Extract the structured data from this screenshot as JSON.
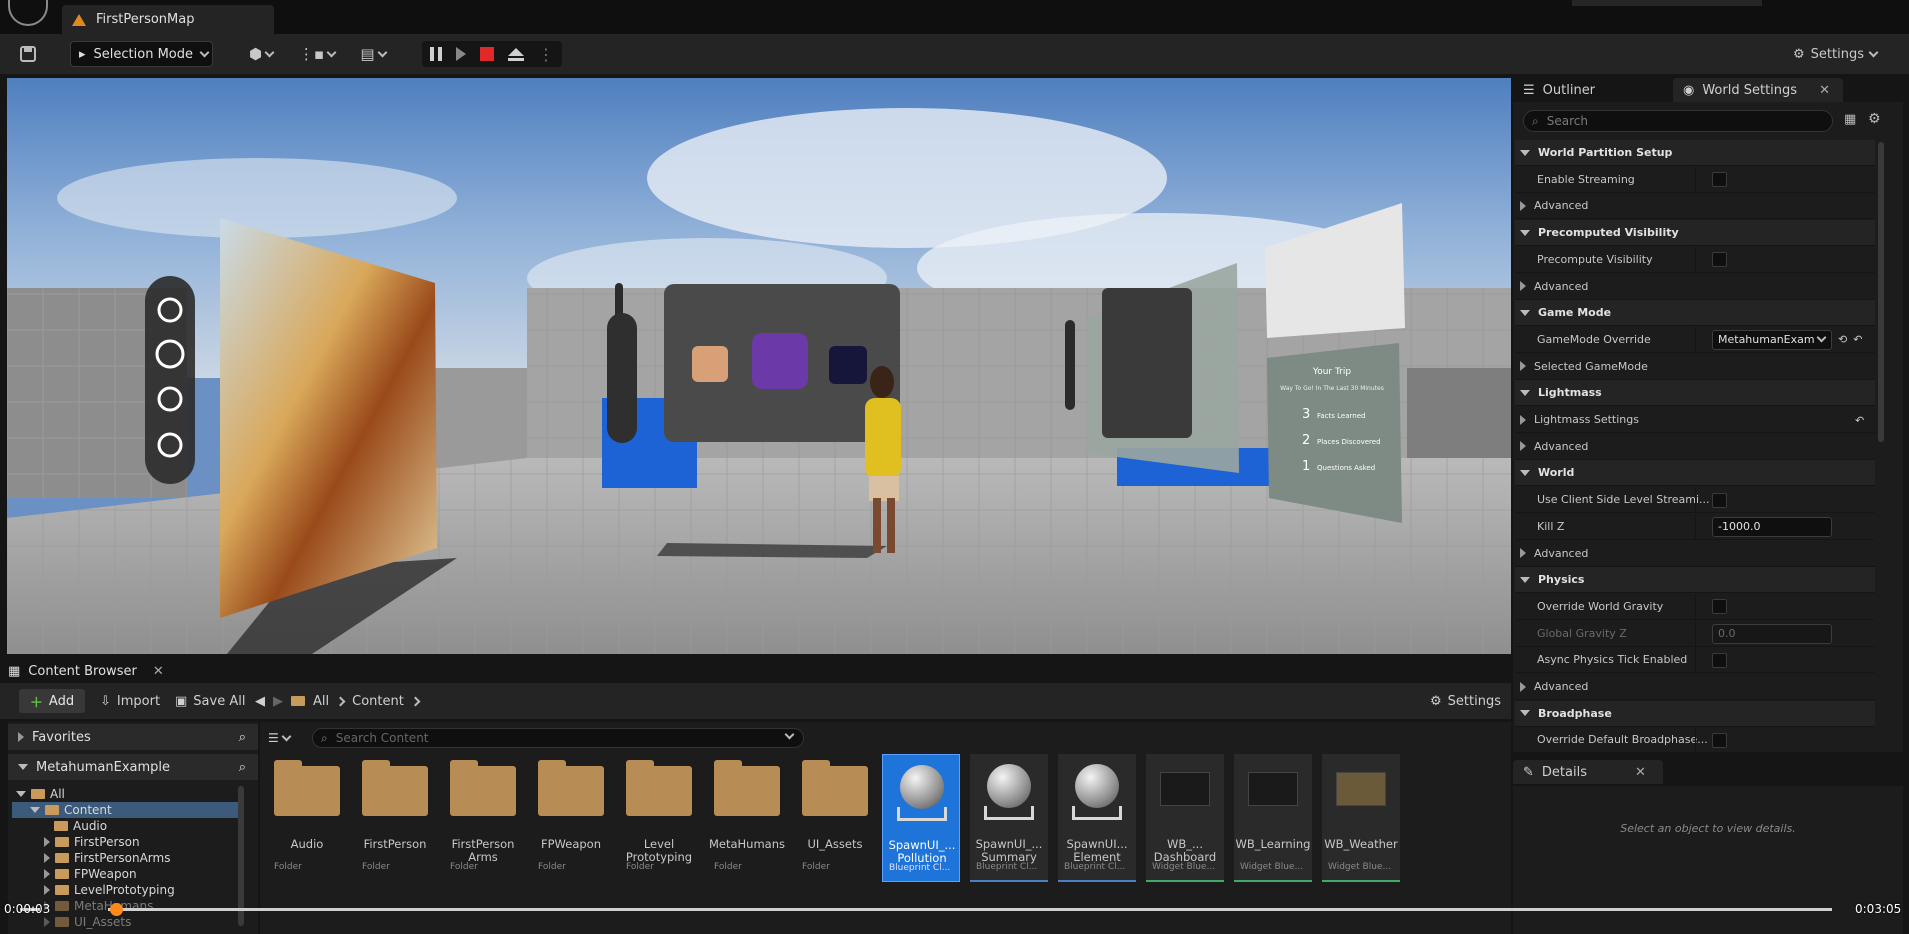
{
  "window": {
    "map_tab": "FirstPersonMap"
  },
  "toolbar": {
    "selection_mode": "Selection Mode",
    "settings": "Settings"
  },
  "viewport": {
    "panel_trip_title": "Your Trip",
    "panel_trip_subtitle": "Way To Go! In The Last 30 Minutes",
    "trip_stats": [
      {
        "num": "3",
        "label": "Facts Learned"
      },
      {
        "num": "2",
        "label": "Places Discovered"
      },
      {
        "num": "1",
        "label": "Questions Asked"
      }
    ]
  },
  "content_browser": {
    "tab": "Content Browser",
    "add": "Add",
    "import": "Import",
    "save_all": "Save All",
    "path": [
      "All",
      "Content"
    ],
    "settings": "Settings",
    "favorites": "Favorites",
    "project": "MetahumanExample",
    "search_placeholder": "Search Content",
    "tree": [
      "All",
      "Content",
      "Audio",
      "FirstPerson",
      "FirstPersonArms",
      "FPWeapon",
      "LevelPrototyping",
      "MetaHumans",
      "UI_Assets"
    ],
    "assets": [
      {
        "name": "Audio",
        "type": "Folder",
        "kind": "folder"
      },
      {
        "name": "FirstPerson",
        "type": "Folder",
        "kind": "folder"
      },
      {
        "name": "FirstPerson Arms",
        "type": "Folder",
        "kind": "folder"
      },
      {
        "name": "FPWeapon",
        "type": "Folder",
        "kind": "folder"
      },
      {
        "name": "Level Prototyping",
        "type": "Folder",
        "kind": "folder"
      },
      {
        "name": "MetaHumans",
        "type": "Folder",
        "kind": "folder"
      },
      {
        "name": "UI_Assets",
        "type": "Folder",
        "kind": "folder"
      },
      {
        "name": "SpawnUI_... Pollution",
        "type": "Blueprint Cl...",
        "kind": "bp-selected"
      },
      {
        "name": "SpawnUI_... Summary",
        "type": "Blueprint Cl...",
        "kind": "bp"
      },
      {
        "name": "SpawnUI... Element",
        "type": "Blueprint Cl...",
        "kind": "bp"
      },
      {
        "name": "WB_... Dashboard",
        "type": "Widget Blue...",
        "kind": "wb"
      },
      {
        "name": "WB_Learning",
        "type": "Widget Blue...",
        "kind": "wb"
      },
      {
        "name": "WB_Weather",
        "type": "Widget Blue...",
        "kind": "wb"
      }
    ]
  },
  "outliner": {
    "tab": "Outliner"
  },
  "world_settings": {
    "tab": "World Settings",
    "search_placeholder": "Search",
    "rows": [
      {
        "kind": "cat",
        "label": "World Partition Setup"
      },
      {
        "kind": "item",
        "label": "Enable Streaming",
        "control": "check"
      },
      {
        "kind": "sub",
        "label": "Advanced"
      },
      {
        "kind": "cat",
        "label": "Precomputed Visibility"
      },
      {
        "kind": "item",
        "label": "Precompute Visibility",
        "control": "check"
      },
      {
        "kind": "sub",
        "label": "Advanced"
      },
      {
        "kind": "cat",
        "label": "Game Mode"
      },
      {
        "kind": "item",
        "label": "GameMode Override",
        "control": "dropdown",
        "value": "MetahumanExam"
      },
      {
        "kind": "sub",
        "label": "Selected GameMode"
      },
      {
        "kind": "cat",
        "label": "Lightmass"
      },
      {
        "kind": "sub",
        "label": "Lightmass Settings",
        "control": "reset"
      },
      {
        "kind": "sub",
        "label": "Advanced"
      },
      {
        "kind": "cat",
        "label": "World"
      },
      {
        "kind": "item",
        "label": "Use Client Side Level Streami...",
        "control": "check"
      },
      {
        "kind": "item",
        "label": "Kill Z",
        "control": "text",
        "value": "-1000.0"
      },
      {
        "kind": "sub",
        "label": "Advanced"
      },
      {
        "kind": "cat",
        "label": "Physics"
      },
      {
        "kind": "item",
        "label": "Override World Gravity",
        "control": "check"
      },
      {
        "kind": "item",
        "label": "Global Gravity Z",
        "control": "text-disabled",
        "value": "0.0"
      },
      {
        "kind": "item",
        "label": "Async Physics Tick Enabled",
        "control": "check"
      },
      {
        "kind": "sub",
        "label": "Advanced"
      },
      {
        "kind": "cat",
        "label": "Broadphase"
      },
      {
        "kind": "item",
        "label": "Override Default Broadphase...",
        "control": "check"
      }
    ]
  },
  "details": {
    "tab": "Details",
    "empty_text": "Select an object to view details."
  },
  "timeline": {
    "current": "0:00:03",
    "total": "0:03:05",
    "progress": 0.011
  }
}
